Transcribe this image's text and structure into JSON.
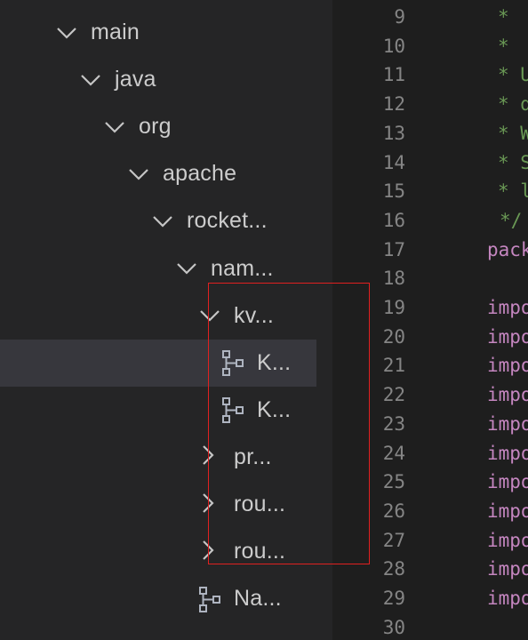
{
  "explorer": {
    "items": [
      {
        "label": "main",
        "kind": "folder",
        "expanded": true,
        "icon": "chevron-down-icon"
      },
      {
        "label": "java",
        "kind": "folder",
        "expanded": true,
        "icon": "chevron-down-icon"
      },
      {
        "label": "org",
        "kind": "folder",
        "expanded": true,
        "icon": "chevron-down-icon"
      },
      {
        "label": "apache",
        "kind": "folder",
        "expanded": true,
        "icon": "chevron-down-icon"
      },
      {
        "label": "rocket...",
        "kind": "folder",
        "expanded": true,
        "icon": "chevron-down-icon"
      },
      {
        "label": "nam...",
        "kind": "folder",
        "expanded": true,
        "icon": "chevron-down-icon"
      },
      {
        "label": "kv...",
        "kind": "folder",
        "expanded": true,
        "icon": "chevron-down-icon"
      },
      {
        "label": "K...",
        "kind": "class",
        "selected": true,
        "icon": "class-hierarchy-icon"
      },
      {
        "label": "K...",
        "kind": "class",
        "icon": "class-hierarchy-icon"
      },
      {
        "label": "pr...",
        "kind": "folder",
        "expanded": false,
        "icon": "chevron-right-icon"
      },
      {
        "label": "rou...",
        "kind": "folder",
        "expanded": false,
        "icon": "chevron-right-icon"
      },
      {
        "label": "rou...",
        "kind": "folder",
        "expanded": false,
        "icon": "chevron-right-icon"
      },
      {
        "label": "Na...",
        "kind": "class",
        "icon": "class-hierarchy-icon"
      }
    ]
  },
  "editor": {
    "lines": [
      {
        "num": "9",
        "text": "*",
        "style": "comment"
      },
      {
        "num": "10",
        "text": "*",
        "style": "comment"
      },
      {
        "num": "11",
        "text": "* U",
        "style": "comment"
      },
      {
        "num": "12",
        "text": "* d",
        "style": "comment"
      },
      {
        "num": "13",
        "text": "* W",
        "style": "comment"
      },
      {
        "num": "14",
        "text": "* S",
        "style": "comment"
      },
      {
        "num": "15",
        "text": "* l",
        "style": "comment"
      },
      {
        "num": "16",
        "text": "*/",
        "style": "comment"
      },
      {
        "num": "17",
        "text": "pack",
        "style": "kw"
      },
      {
        "num": "18",
        "text": "",
        "style": "kw"
      },
      {
        "num": "19",
        "text": "impo",
        "style": "kw"
      },
      {
        "num": "20",
        "text": "impo",
        "style": "kw"
      },
      {
        "num": "21",
        "text": "impo",
        "style": "kw"
      },
      {
        "num": "22",
        "text": "impo",
        "style": "kw"
      },
      {
        "num": "23",
        "text": "impo",
        "style": "kw"
      },
      {
        "num": "24",
        "text": "impo",
        "style": "kw"
      },
      {
        "num": "25",
        "text": "impo",
        "style": "kw"
      },
      {
        "num": "26",
        "text": "impo",
        "style": "kw"
      },
      {
        "num": "27",
        "text": "impo",
        "style": "kw"
      },
      {
        "num": "28",
        "text": "impo",
        "style": "kw"
      },
      {
        "num": "29",
        "text": "impo",
        "style": "kw"
      },
      {
        "num": "30",
        "text": "",
        "style": "kw"
      }
    ]
  },
  "colors": {
    "explorer_bg": "#252526",
    "editor_bg": "#1e1e1e",
    "selection_bg": "#37373d",
    "comment": "#6a9955",
    "keyword": "#c586c0",
    "line_number": "#858585",
    "annotation_box": "#e02020"
  }
}
